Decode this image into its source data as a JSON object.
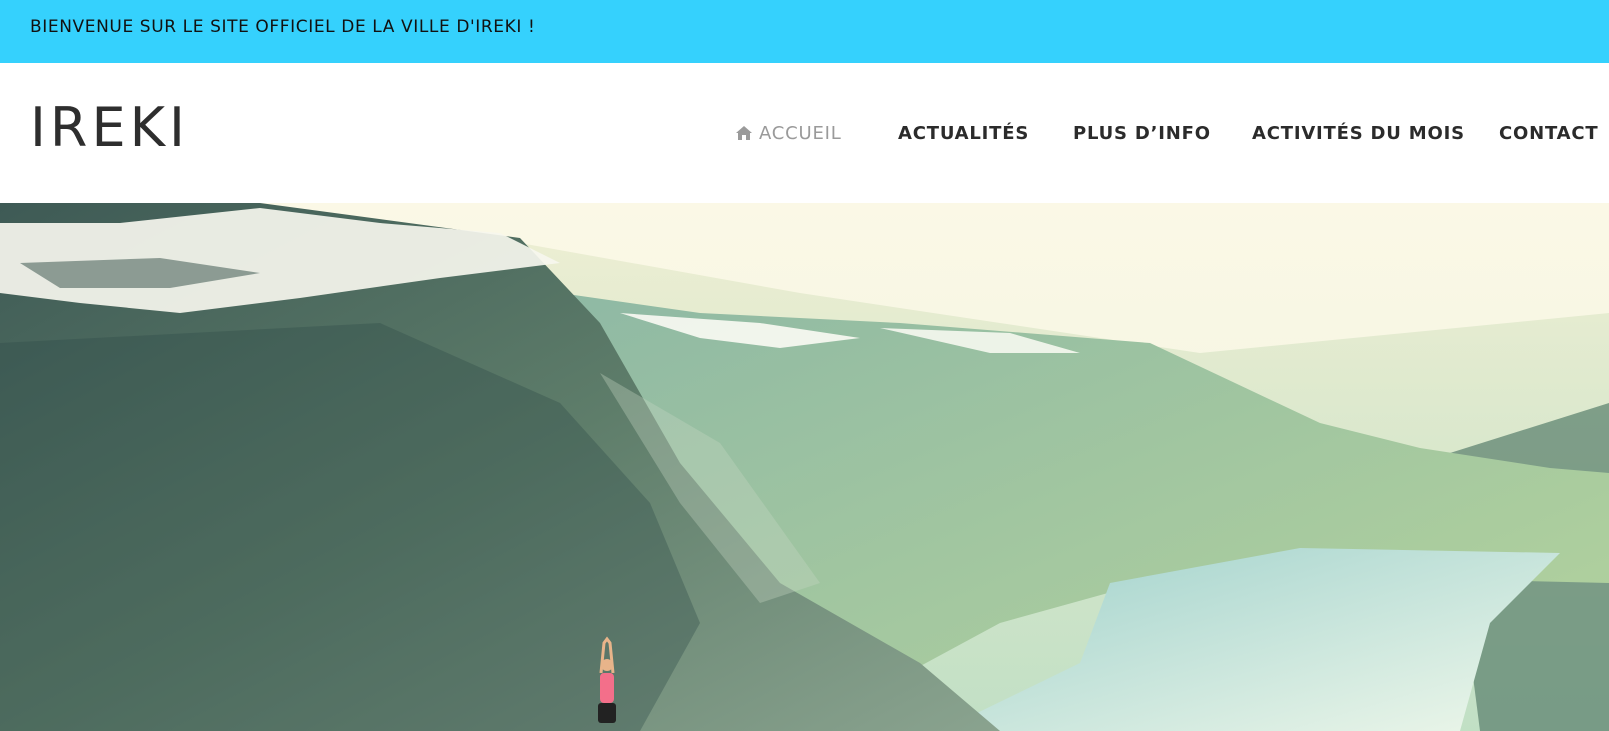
{
  "banner": {
    "text": "BIENVENUE SUR LE SITE OFFICIEL DE LA VILLE D'IREKI !"
  },
  "site": {
    "logo": "IREKI"
  },
  "nav": {
    "items": [
      {
        "label": "ACCUEIL",
        "icon": "home-icon",
        "active": true
      },
      {
        "label": "ACTUALITÉS"
      },
      {
        "label": "PLUS D’INFO"
      },
      {
        "label": "ACTIVITÉS DU MOIS"
      },
      {
        "label": "CONTACT"
      }
    ]
  },
  "colors": {
    "banner_bg": "#35d1fd",
    "nav_active": "#9a9a9a",
    "text_dark": "#2b2b2b"
  },
  "hero": {
    "image": "mountain fjord landscape with person doing yoga pose on cliff"
  }
}
